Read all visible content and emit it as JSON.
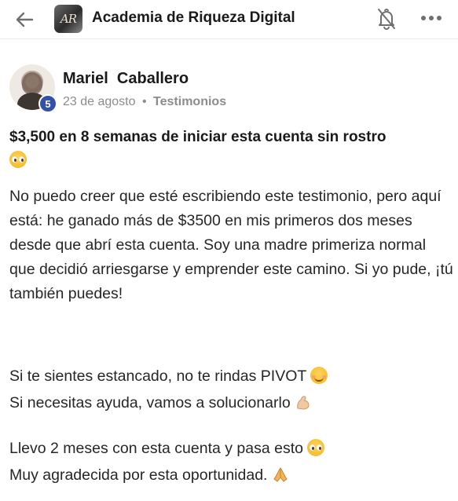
{
  "header": {
    "title": "Academia de Riqueza Digital",
    "logo_text": "AR",
    "back_icon": "arrow-left-icon",
    "bell_icon": "bell-off-icon",
    "more_icon": "more-horizontal-icon"
  },
  "post": {
    "author": {
      "name": "Mariel  Caballero",
      "level": "5"
    },
    "date": "23 de agosto",
    "separator": "•",
    "category": "Testimonios",
    "title": "$3,500 en 8 semanas de iniciar esta cuenta sin rostro",
    "paragraphs": [
      "No puedo creer que esté escribiendo este testimonio, pero aquí está: he ganado más de $3500 en mis primeros dos meses desde que abrí esta cuenta. Soy una madre primeriza normal que decidió arriesgarse y emprender este camino. Si yo pude, ¡tú también puedes!",
      "Si te sientes estancado, no te rindas PIVOT",
      "Si necesitas ayuda, vamos a solucionarlo",
      "Llevo 2 meses con esta cuenta y pasa esto",
      "Muy agradecida por esta oportunidad."
    ]
  },
  "colors": {
    "badge": "#3550a8",
    "meta_text": "#8c8c8c",
    "divider": "#e6e6e6"
  }
}
